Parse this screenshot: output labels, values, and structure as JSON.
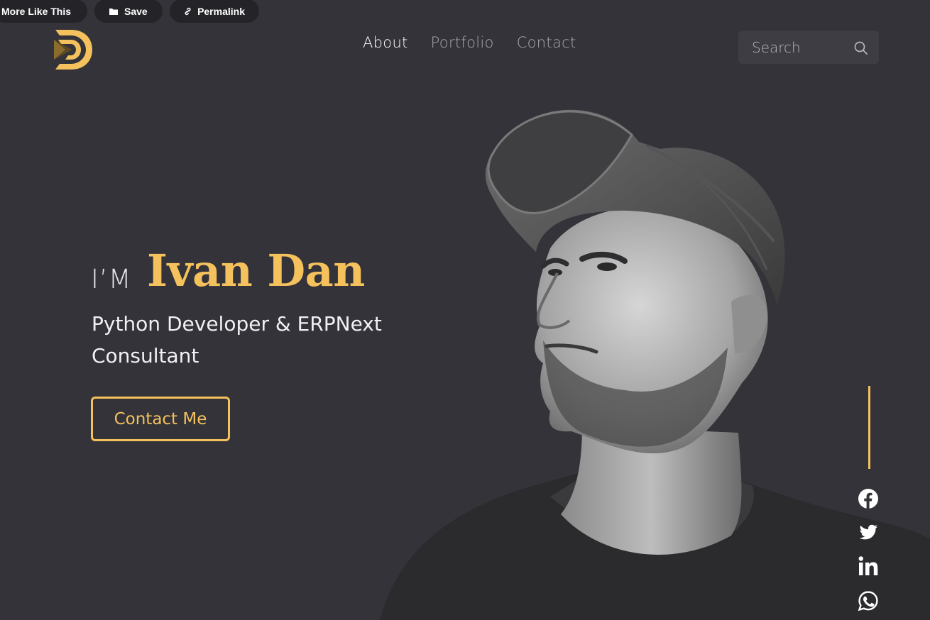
{
  "toolbar": {
    "more_like_this": "More Like This",
    "save": "Save",
    "permalink": "Permalink"
  },
  "nav": {
    "items": [
      {
        "label": "About",
        "active": true
      },
      {
        "label": "Portfolio",
        "active": false
      },
      {
        "label": "Contact",
        "active": false
      }
    ]
  },
  "search": {
    "placeholder": "Search",
    "icon": "search-icon"
  },
  "hero": {
    "prefix": "I’M",
    "name": "Ivan Dan",
    "role_line1": "Python Developer & ERPNext",
    "role_line2": "Consultant",
    "cta_label": "Contact Me"
  },
  "social": [
    "facebook-icon",
    "twitter-icon",
    "linkedin-icon",
    "whatsapp-icon"
  ],
  "colors": {
    "background": "#333339",
    "accent": "#f4c15d",
    "nav_inactive": "#a7a7ad",
    "search_bg": "#3d3d43",
    "pill_bg": "#232328"
  }
}
